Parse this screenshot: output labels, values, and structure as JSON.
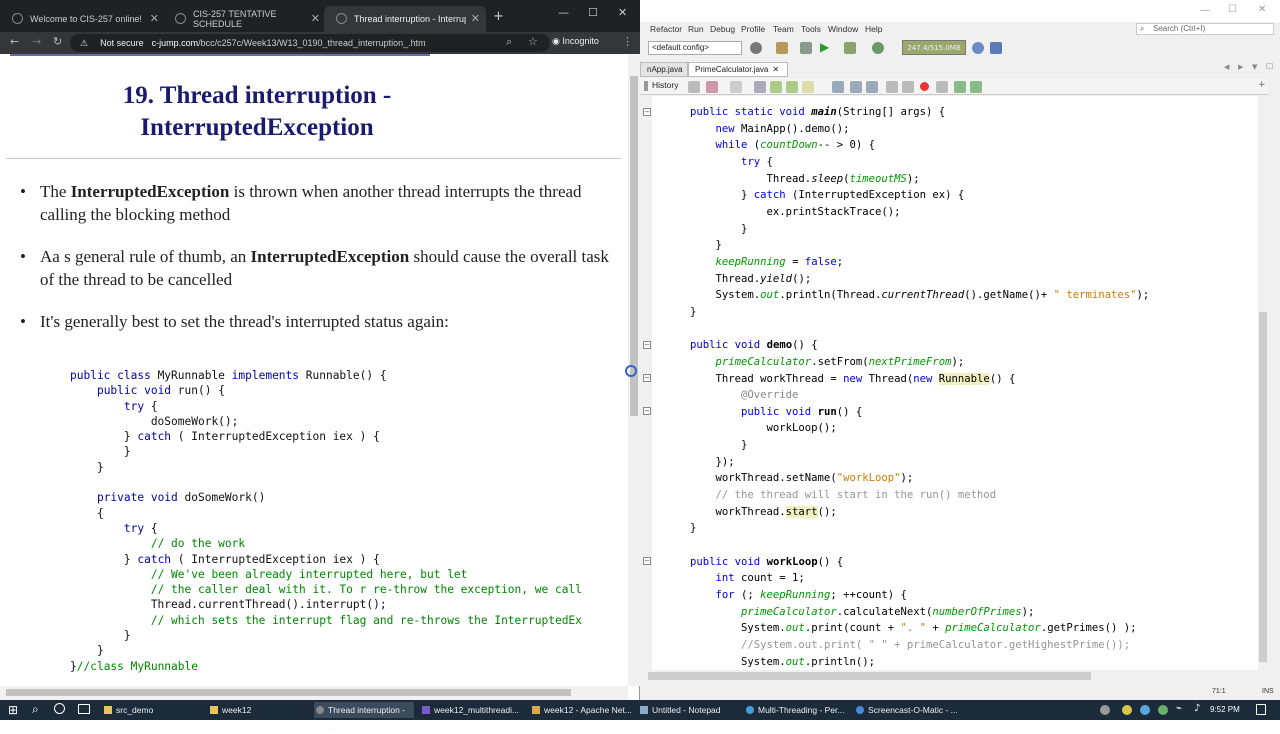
{
  "browser": {
    "tabs": [
      {
        "label": "Welcome to CIS-257 online!"
      },
      {
        "label": "CIS-257 TENTATIVE SCHEDULE"
      },
      {
        "label": "Thread interruption - Interrupted"
      }
    ],
    "security_label": "Not secure",
    "url_host": "c-jump.com",
    "url_path": "/bcc/c257c/Week13/W13_0190_thread_interruption_.htm",
    "incognito_label": "Incognito"
  },
  "page": {
    "title_line1": "19. Thread interruption -",
    "title_line2": "InterruptedException",
    "bullets": [
      {
        "pre": "The ",
        "bold": "InterruptedException",
        "post": " is thrown when another thread interrupts the thread calling the blocking method"
      },
      {
        "pre": "Aa s general rule of thumb, an ",
        "bold": "InterruptedException",
        "post": " should cause the overall task of the thread to be cancelled"
      },
      {
        "pre": "It's generally best to set the thread's interrupted status again:",
        "bold": "",
        "post": ""
      }
    ]
  },
  "ide": {
    "menu": [
      "Refactor",
      "Run",
      "Debug",
      "Profile",
      "Team",
      "Tools",
      "Window",
      "Help"
    ],
    "search_placeholder": "Search (Ctrl+I)",
    "config": "<default config>",
    "memory": "247.4/515.0MB",
    "file_tabs": [
      "nApp.java",
      "PrimeCalculator.java"
    ],
    "history_label": "History",
    "position": "71:1",
    "mode": "INS"
  },
  "taskbar": {
    "items": [
      "src_demo",
      "week12",
      "Thread interruption - ...",
      "week12_multithreadi...",
      "week12 - Apache Net...",
      "Untitled - Notepad",
      "Multi-Threading - Per...",
      "Screencast-O-Matic - ..."
    ],
    "time": "9:52 PM"
  },
  "colors": {
    "browser_dark": "#202124",
    "heading": "#1a1a6e",
    "keyword": "#0000aa",
    "taskbar": "#1c2b3a"
  }
}
